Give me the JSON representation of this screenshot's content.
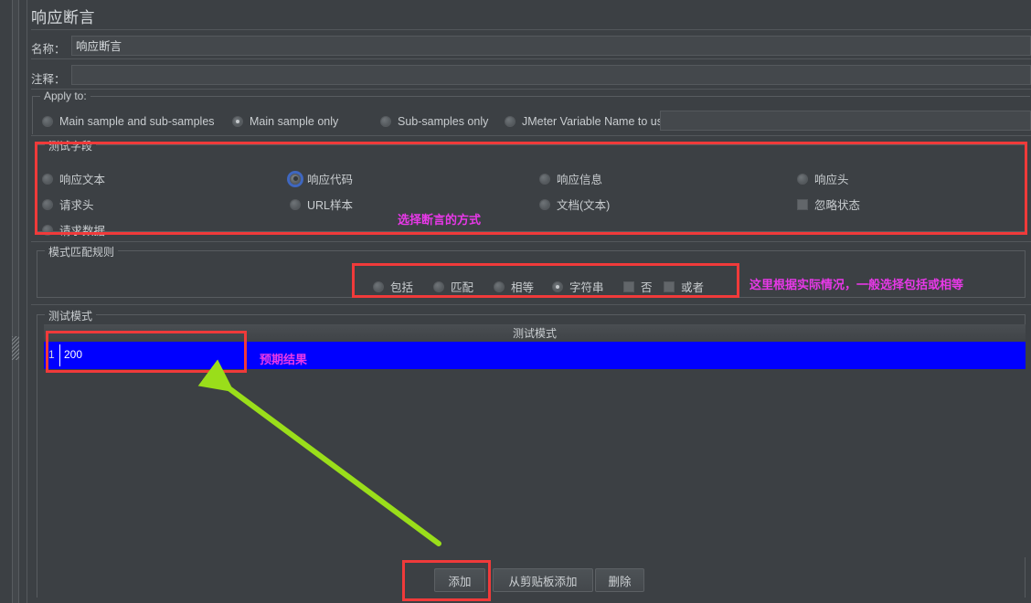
{
  "window": {
    "title": "响应断言",
    "background_color": "#3c4044"
  },
  "fields": {
    "name_label": "名称：",
    "name_value": "响应断言",
    "comment_label": "注释：",
    "comment_value": ""
  },
  "apply_to": {
    "legend": "Apply to:",
    "options": [
      {
        "label": "Main sample and sub-samples",
        "selected": false
      },
      {
        "label": "Main sample only",
        "selected": true
      },
      {
        "label": "Sub-samples only",
        "selected": false
      },
      {
        "label": "JMeter Variable Name to use",
        "selected": false
      }
    ],
    "variable_value": ""
  },
  "test_field": {
    "legend": "测试字段",
    "options": [
      {
        "label": "响应文本",
        "selected": false
      },
      {
        "label": "请求头",
        "selected": false
      },
      {
        "label": "请求数据",
        "selected": false
      },
      {
        "label": "响应代码",
        "selected": true
      },
      {
        "label": "URL样本",
        "selected": false
      },
      {
        "label": "响应信息",
        "selected": false
      },
      {
        "label": "文档(文本)",
        "selected": false
      },
      {
        "label": "响应头",
        "selected": false
      }
    ],
    "ignore_status": {
      "label": "忽略状态",
      "checked": false
    },
    "annotation": "选择断言的方式"
  },
  "pattern_rules": {
    "legend": "模式匹配规则",
    "radios": [
      {
        "label": "包括",
        "selected": false
      },
      {
        "label": "匹配",
        "selected": false
      },
      {
        "label": "相等",
        "selected": false
      },
      {
        "label": "字符串",
        "selected": true
      }
    ],
    "checkboxes": [
      {
        "label": "否",
        "checked": false
      },
      {
        "label": "或者",
        "checked": false
      }
    ],
    "annotation": "这里根据实际情况，一般选择包括或相等"
  },
  "test_patterns": {
    "legend": "测试模式",
    "column_header": "测试模式",
    "rows": [
      {
        "index": "1",
        "value": "200",
        "selected": true
      }
    ],
    "annotation": "预期结果",
    "selection_color": "#0000ff"
  },
  "buttons": {
    "add": "添加",
    "add_from_clipboard": "从剪贴板添加",
    "delete": "删除"
  },
  "annotation_colors": {
    "text": "#e838e8",
    "box": "#f03a3a",
    "arrow": "#9ade1a"
  }
}
